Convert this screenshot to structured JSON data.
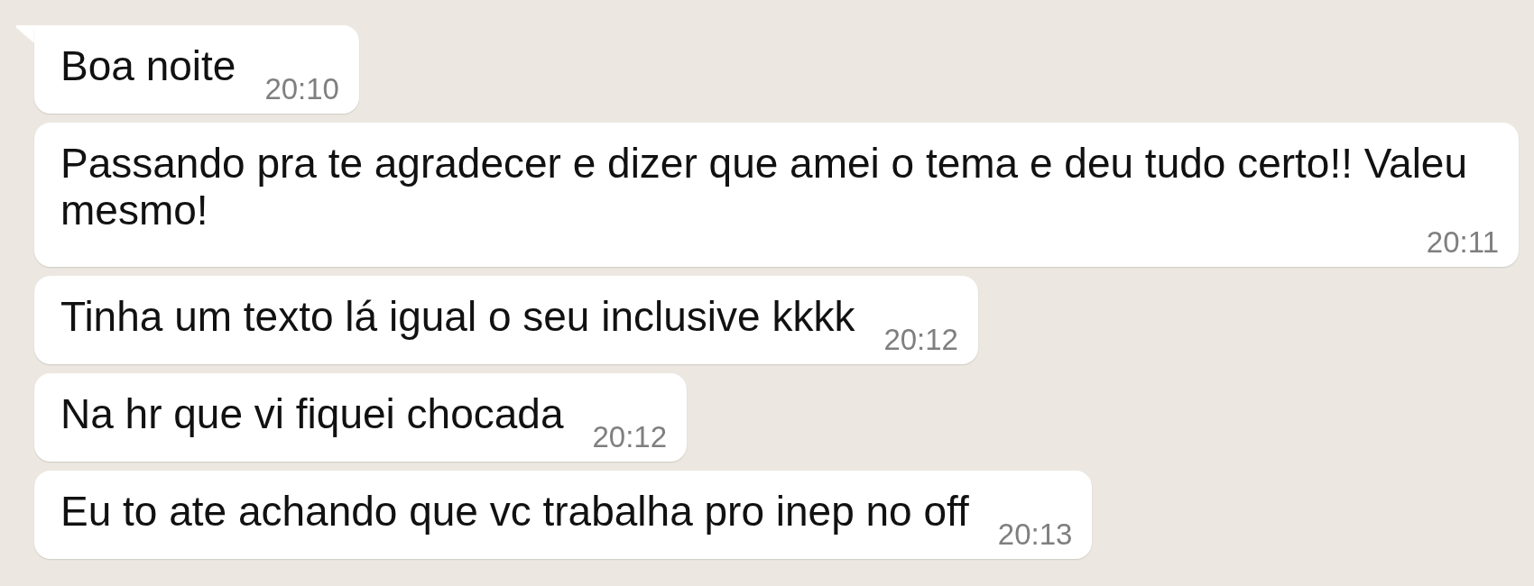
{
  "messages": [
    {
      "text": "Boa noite",
      "time": "20:10",
      "tail": true
    },
    {
      "text": "Passando pra te agradecer e dizer que amei o tema e deu tudo certo!! Valeu mesmo!",
      "time": "20:11",
      "tail": false
    },
    {
      "text": "Tinha um texto lá igual o seu inclusive kkkk",
      "time": "20:12",
      "tail": false
    },
    {
      "text": "Na hr que vi fiquei chocada",
      "time": "20:12",
      "tail": false
    },
    {
      "text": "Eu to ate achando que vc trabalha pro inep no off",
      "time": "20:13",
      "tail": false
    }
  ]
}
